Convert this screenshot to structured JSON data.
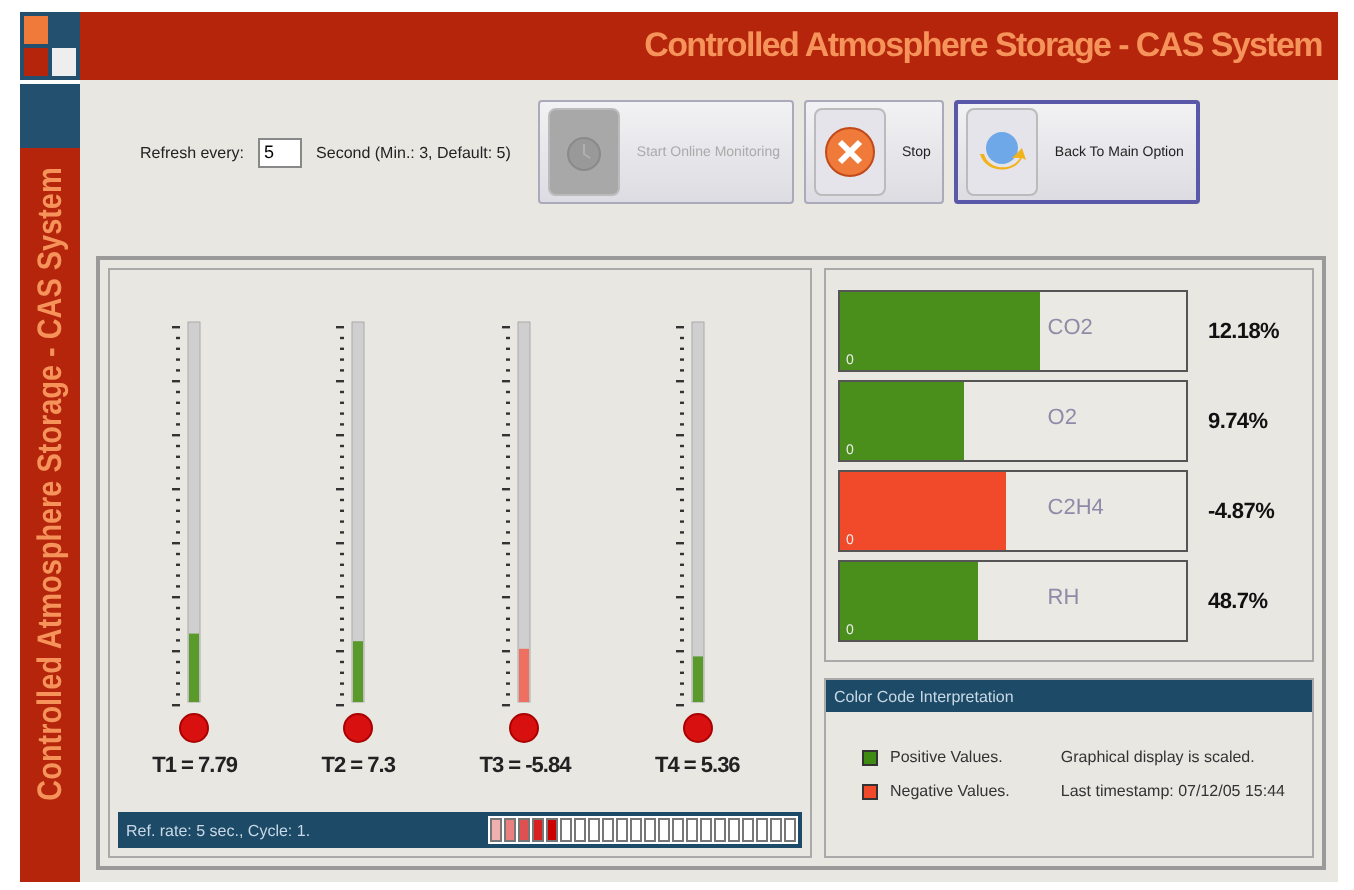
{
  "window": {
    "title": "Controlled Atmosphere Storage - CAS System",
    "side_title": "Controlled Atmosphere Storage - CAS System"
  },
  "toolbar": {
    "refresh_label": "Refresh every:",
    "refresh_value": "5",
    "refresh_hint": "Second  (Min.: 3, Default: 5)",
    "buttons": [
      {
        "label": "Start Online Monitoring",
        "kind": "start",
        "disabled": true,
        "selected": false
      },
      {
        "label": "Stop",
        "kind": "stop",
        "disabled": false,
        "selected": false
      },
      {
        "label": "Back To Main Option",
        "kind": "back",
        "disabled": false,
        "selected": true
      }
    ]
  },
  "thermometers": [
    {
      "label": "T1 = 7.79",
      "level": 0.18,
      "color": "#5a9a2a"
    },
    {
      "label": "T2 = 7.3",
      "level": 0.16,
      "color": "#5a9a2a"
    },
    {
      "label": "T3 = -5.84",
      "level": 0.14,
      "color": "#ef7060"
    },
    {
      "label": "T4 = 5.36",
      "level": 0.12,
      "color": "#5a9a2a"
    }
  ],
  "status_bar": {
    "text": "Ref. rate: 5 sec., Cycle: 1.",
    "level": 0.23
  },
  "gases": [
    {
      "name": "CO2",
      "min": "0",
      "level": 0.58,
      "color": "#4a8f1c",
      "reading": "12.18%"
    },
    {
      "name": "O2",
      "min": "0",
      "level": 0.36,
      "color": "#4a8f1c",
      "reading": "9.74%"
    },
    {
      "name": "C2H4",
      "min": "0",
      "level": 0.48,
      "color": "#f04a2a",
      "reading": "-4.87%"
    },
    {
      "name": "RH",
      "min": "0",
      "level": 0.4,
      "color": "#4a8f1c",
      "reading": "48.7%"
    }
  ],
  "legend": {
    "title": "Color Code Interpretation",
    "items": [
      {
        "label": "Positive Values.",
        "note": "Graphical display is scaled.",
        "color": "#3f8a12"
      },
      {
        "label": "Negative Values.",
        "note": "Last timestamp: 07/12/05 15:44",
        "color": "#f04a2a"
      }
    ]
  }
}
